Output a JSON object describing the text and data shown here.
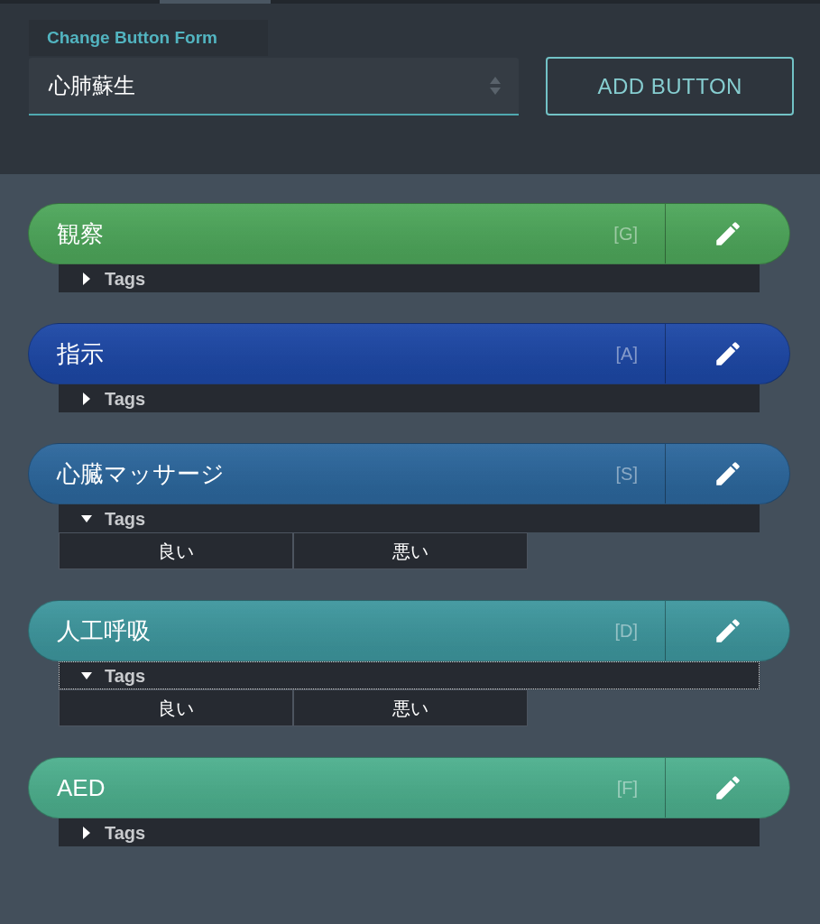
{
  "form": {
    "label": "Change Button Form",
    "select": {
      "value": "心肺蘇生"
    },
    "add_button": "ADD BUTTON"
  },
  "buttons": [
    {
      "label": "観察",
      "key": "[G]",
      "color": "#4ea75b",
      "tags": {
        "label": "Tags",
        "expanded": false,
        "focused": false
      }
    },
    {
      "label": "指示",
      "key": "[A]",
      "color": "#1d48a6",
      "tags": {
        "label": "Tags",
        "expanded": false,
        "focused": false
      }
    },
    {
      "label": "心臓マッサージ",
      "key": "[S]",
      "color": "#2c679d",
      "tags": {
        "label": "Tags",
        "expanded": true,
        "focused": false,
        "items": [
          "良い",
          "悪い"
        ]
      }
    },
    {
      "label": "人工呼吸",
      "key": "[D]",
      "color": "#3e979e",
      "tags": {
        "label": "Tags",
        "expanded": true,
        "focused": true,
        "items": [
          "良い",
          "悪い"
        ]
      }
    },
    {
      "label": "AED",
      "key": "[F]",
      "color": "#4db08e",
      "tags": {
        "label": "Tags",
        "expanded": false,
        "focused": false
      }
    }
  ]
}
